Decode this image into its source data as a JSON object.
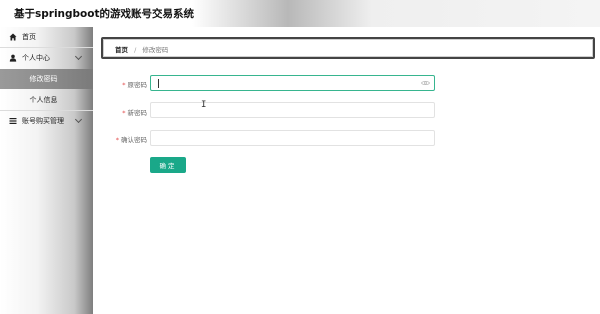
{
  "header": {
    "title": "基于springboot的游戏账号交易系统"
  },
  "sidebar": {
    "home": "首页",
    "personal_center": "个人中心",
    "personal_sub": [
      "修改密码",
      "个人信息"
    ],
    "account_trade": "账号购买管理"
  },
  "breadcrumb": {
    "home": "首页",
    "separator": "/",
    "current": "修改密码"
  },
  "form": {
    "old_password_label": "原密码",
    "new_password_label": "新密码",
    "confirm_password_label": "确认密码",
    "required_mark": "*",
    "old_password_value": "",
    "new_password_value": "",
    "confirm_password_value": "",
    "submit_label": "确定"
  },
  "colors": {
    "accent": "#1aa889",
    "focus_border": "#37b58f",
    "required": "#e24c4c"
  },
  "icons": {
    "home": "home-icon",
    "user": "user-icon",
    "menu": "list-icon",
    "eye": "eye-icon"
  }
}
